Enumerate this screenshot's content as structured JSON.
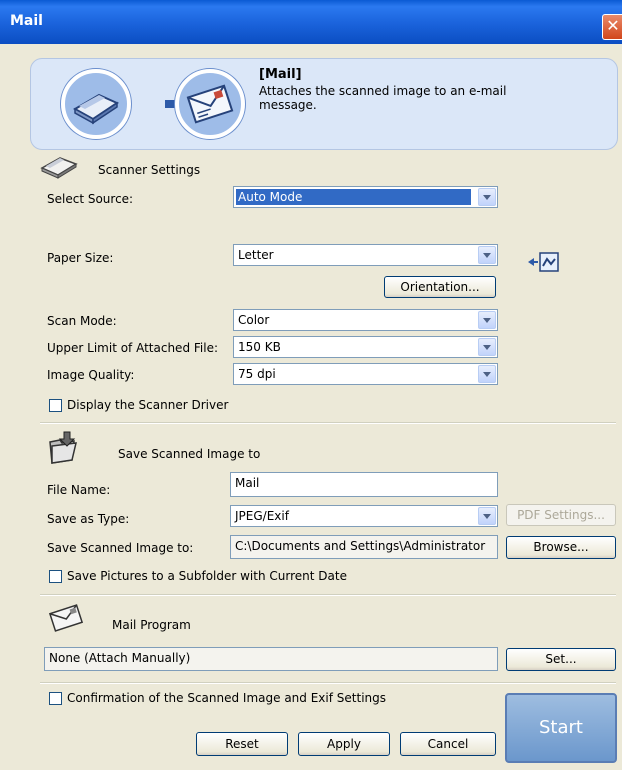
{
  "window": {
    "title": "Mail",
    "close_glyph": "✕"
  },
  "banner": {
    "title": "[Mail]",
    "description": "Attaches the scanned image to an e-mail message.",
    "icons": [
      "scanner-icon",
      "arrow-right-icon",
      "mail-icon"
    ]
  },
  "scanner_settings": {
    "heading": "Scanner Settings",
    "select_source": {
      "label": "Select Source:",
      "value": "Auto Mode"
    },
    "paper_size": {
      "label": "Paper Size:",
      "value": "Letter"
    },
    "orientation_button": "Orientation...",
    "scan_mode": {
      "label": "Scan Mode:",
      "value": "Color"
    },
    "upper_limit": {
      "label": "Upper Limit of Attached File:",
      "value": "150 KB"
    },
    "image_quality": {
      "label": "Image Quality:",
      "value": "75 dpi"
    },
    "display_driver": {
      "label": "Display the Scanner Driver",
      "checked": false
    }
  },
  "save_settings": {
    "heading": "Save Scanned Image to",
    "file_name": {
      "label": "File Name:",
      "value": "Mail"
    },
    "save_as_type": {
      "label": "Save as Type:",
      "value": "JPEG/Exif"
    },
    "pdf_settings_button": "PDF Settings...",
    "save_to": {
      "label": "Save Scanned Image to:",
      "value": "C:\\Documents and Settings\\Administrator"
    },
    "browse_button": "Browse...",
    "subfolder": {
      "label": "Save Pictures to a Subfolder with Current Date",
      "checked": false
    }
  },
  "mail_program": {
    "heading": "Mail Program",
    "value": "None (Attach Manually)",
    "set_button": "Set..."
  },
  "footer": {
    "confirmation": {
      "label": "Confirmation of the Scanned Image and Exif Settings",
      "checked": false
    },
    "reset_button": "Reset",
    "apply_button": "Apply",
    "cancel_button": "Cancel",
    "start_button": "Start"
  },
  "colors": {
    "titlebar": "#0a5ad3",
    "selection": "#316ac5",
    "dialog_bg": "#ece9d8",
    "banner_bg": "#dbe7f8",
    "start_bg": "#7ea6d6"
  }
}
